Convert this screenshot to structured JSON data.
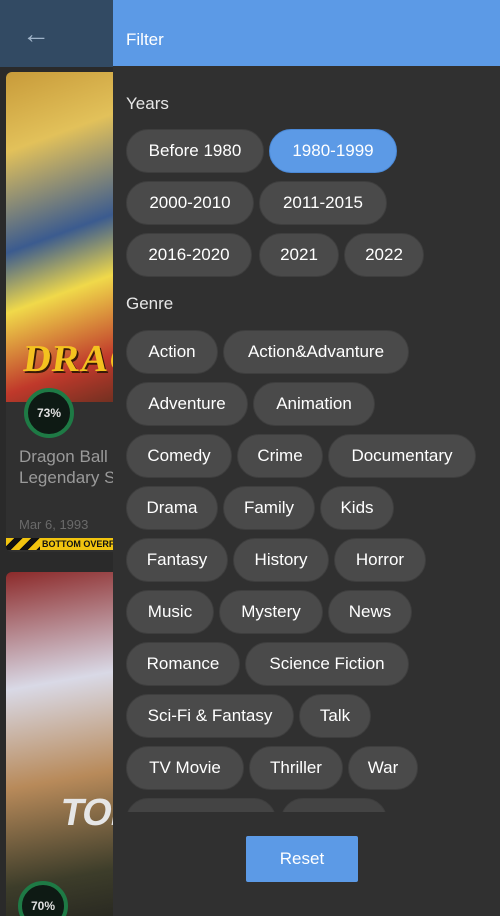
{
  "background": {
    "cards": [
      {
        "poster_text": "DRAGON",
        "rating": "73%",
        "title": "Dragon Ball Z: The Legendary Saiyan",
        "date": "Mar 6, 1993",
        "overflow_label": "BOTTOM OVERFL"
      },
      {
        "poster_text": "TOP",
        "rating": "70%"
      }
    ]
  },
  "drawer": {
    "title": "Filter",
    "years_label": "Years",
    "years": [
      {
        "label": "Before 1980",
        "selected": false
      },
      {
        "label": "1980-1999",
        "selected": true
      },
      {
        "label": "2000-2010",
        "selected": false
      },
      {
        "label": "2011-2015",
        "selected": false
      },
      {
        "label": "2016-2020",
        "selected": false
      },
      {
        "label": "2021",
        "selected": false
      },
      {
        "label": "2022",
        "selected": false
      }
    ],
    "genre_label": "Genre",
    "genres": [
      {
        "label": "Action"
      },
      {
        "label": "Action&Advanture"
      },
      {
        "label": "Adventure"
      },
      {
        "label": "Animation"
      },
      {
        "label": "Comedy"
      },
      {
        "label": "Crime"
      },
      {
        "label": "Documentary"
      },
      {
        "label": "Drama"
      },
      {
        "label": "Family"
      },
      {
        "label": "Kids"
      },
      {
        "label": "Fantasy"
      },
      {
        "label": "History"
      },
      {
        "label": "Horror"
      },
      {
        "label": "Music"
      },
      {
        "label": "Mystery"
      },
      {
        "label": "News"
      },
      {
        "label": "Romance"
      },
      {
        "label": "Science Fiction"
      },
      {
        "label": "Sci-Fi & Fantasy"
      },
      {
        "label": "Talk"
      },
      {
        "label": "TV Movie"
      },
      {
        "label": "Thriller"
      },
      {
        "label": "War"
      }
    ],
    "reset_label": "Reset"
  },
  "colors": {
    "accent": "#5c9ae6",
    "chip": "#4a4a4a",
    "drawer_bg": "#303030",
    "appbar": "#324a63"
  }
}
